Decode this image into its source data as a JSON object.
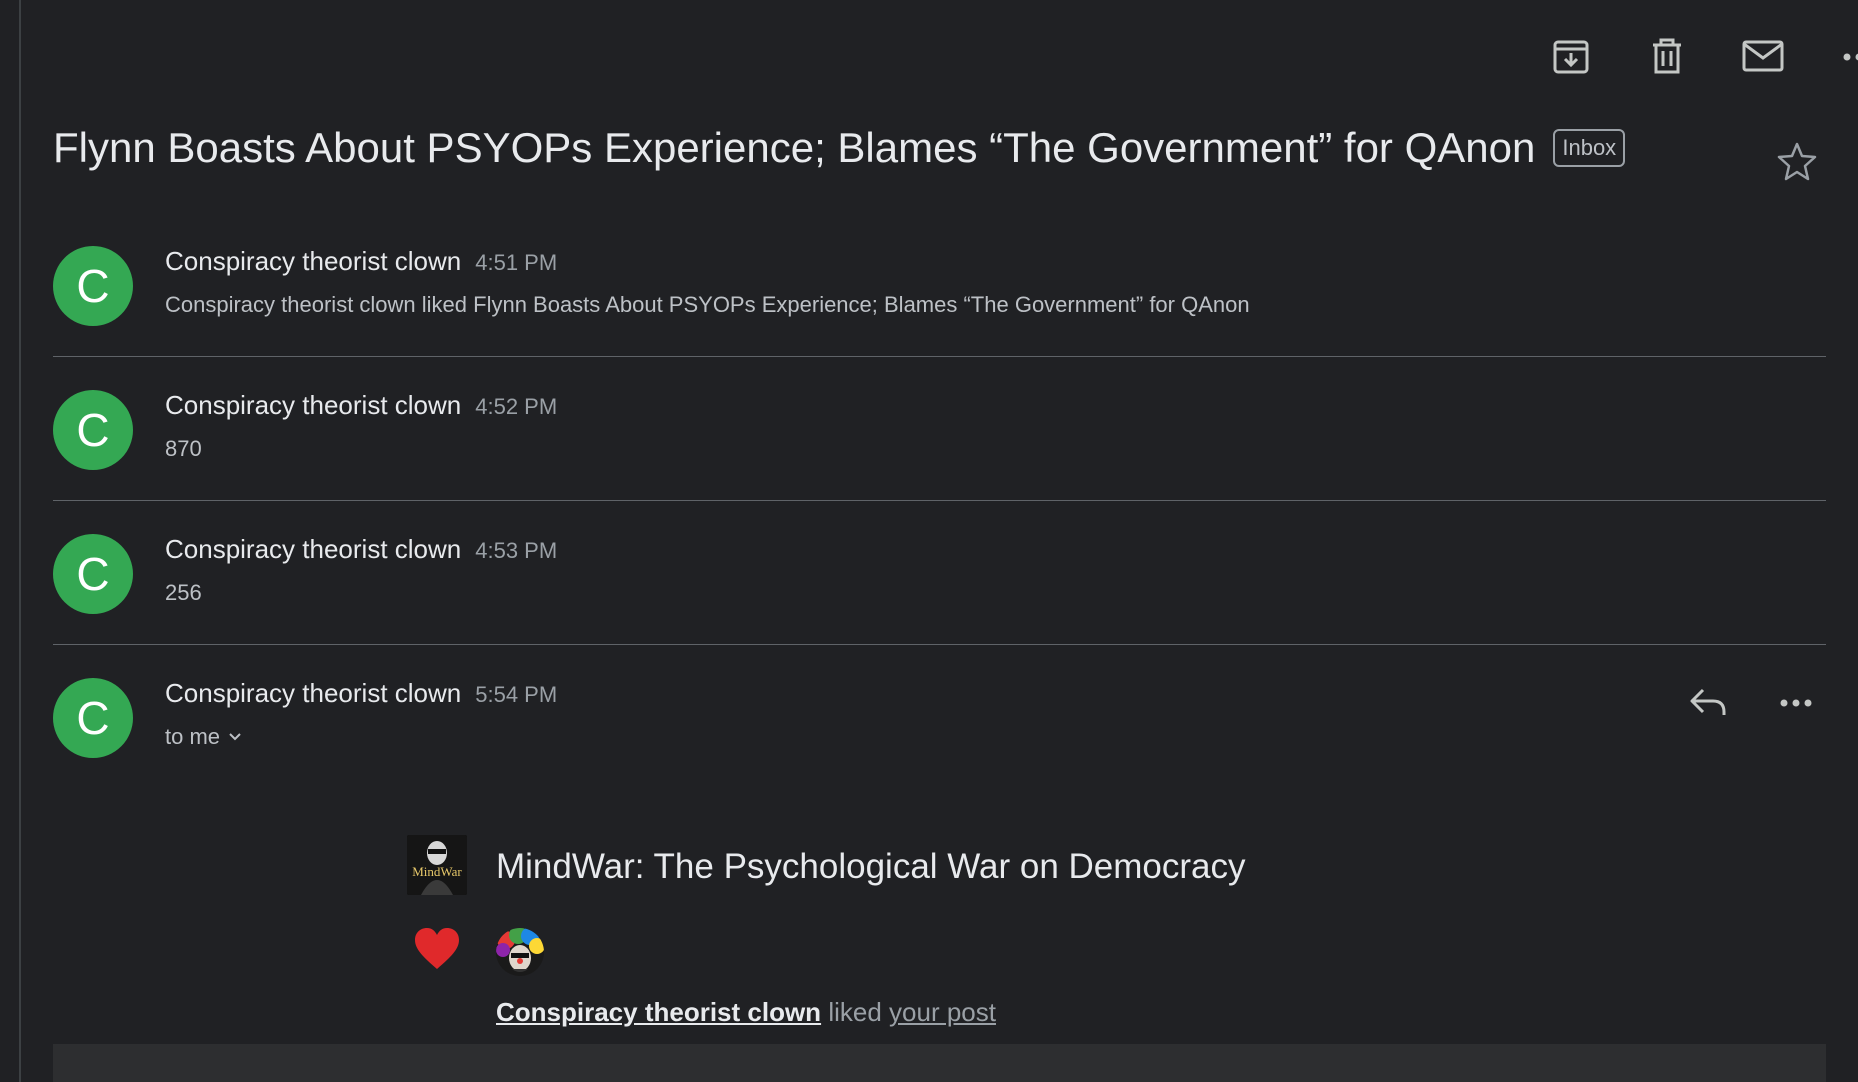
{
  "toolbar": {
    "icons": [
      "archive-icon",
      "trash-icon",
      "mail-icon",
      "more-icon"
    ]
  },
  "thread": {
    "subject": "Flynn Boasts About PSYOPs Experience; Blames “The Government” for QAnon",
    "label": "Inbox"
  },
  "messages": [
    {
      "avatar_letter": "C",
      "sender": "Conspiracy theorist clown",
      "time": "4:51 PM",
      "snippet": "Conspiracy theorist clown liked Flynn Boasts About PSYOPs Experience; Blames “The Government” for QAnon"
    },
    {
      "avatar_letter": "C",
      "sender": "Conspiracy theorist clown",
      "time": "4:52 PM",
      "snippet": "870"
    },
    {
      "avatar_letter": "C",
      "sender": "Conspiracy theorist clown",
      "time": "4:53 PM",
      "snippet": "256"
    },
    {
      "avatar_letter": "C",
      "sender": "Conspiracy theorist clown",
      "time": "5:54 PM",
      "recipient": "to me"
    }
  ],
  "email_body": {
    "publication_logo_text": "MindWar",
    "publication_title": "MindWar: The Psychological War on Democracy",
    "liker_name": "Conspiracy theorist clown",
    "liked_word": "liked",
    "post_link": "your post"
  },
  "colors": {
    "background": "#202124",
    "avatar": "#34a853",
    "heart": "#e0292b"
  }
}
